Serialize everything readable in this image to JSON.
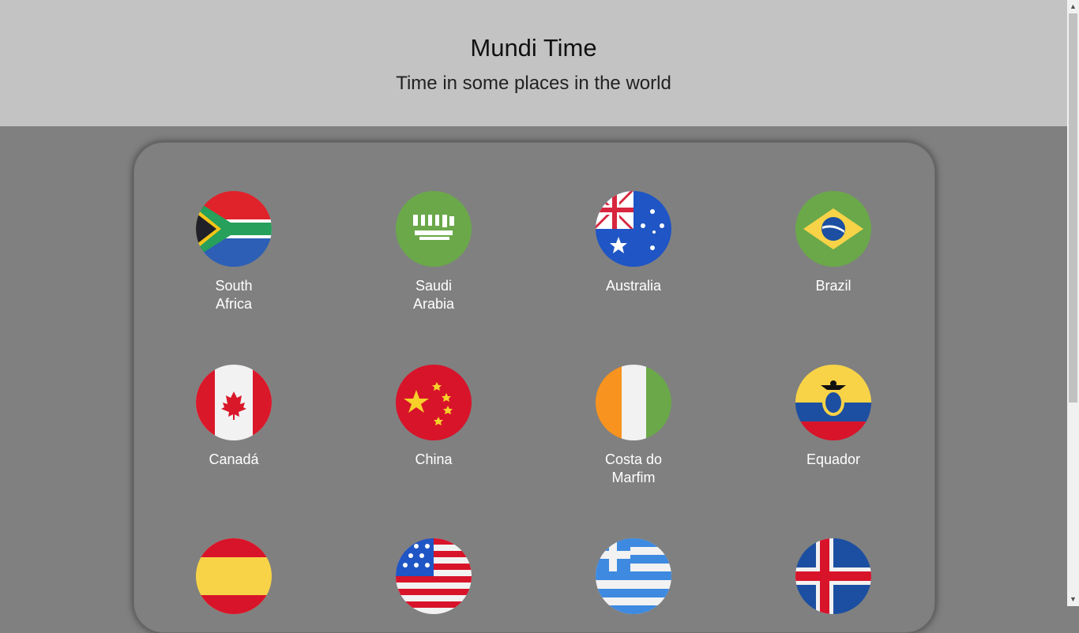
{
  "header": {
    "title": "Mundi Time",
    "subtitle": "Time in some places in the world"
  },
  "countries": [
    {
      "name": "South Africa",
      "flag_icon": "south-africa-flag-icon"
    },
    {
      "name": "Saudi Arabia",
      "flag_icon": "saudi-arabia-flag-icon"
    },
    {
      "name": "Australia",
      "flag_icon": "australia-flag-icon"
    },
    {
      "name": "Brazil",
      "flag_icon": "brazil-flag-icon"
    },
    {
      "name": "Canadá",
      "flag_icon": "canada-flag-icon"
    },
    {
      "name": "China",
      "flag_icon": "china-flag-icon"
    },
    {
      "name": "Costa do Marfim",
      "flag_icon": "ivory-coast-flag-icon"
    },
    {
      "name": "Equador",
      "flag_icon": "ecuador-flag-icon"
    },
    {
      "name": "",
      "flag_icon": "spain-flag-icon"
    },
    {
      "name": "",
      "flag_icon": "usa-flag-icon"
    },
    {
      "name": "",
      "flag_icon": "greece-flag-icon"
    },
    {
      "name": "",
      "flag_icon": "iceland-flag-icon"
    }
  ],
  "colors": {
    "page_background": "#808080",
    "header_background": "#c3c3c3",
    "label_text": "#ffffff"
  }
}
